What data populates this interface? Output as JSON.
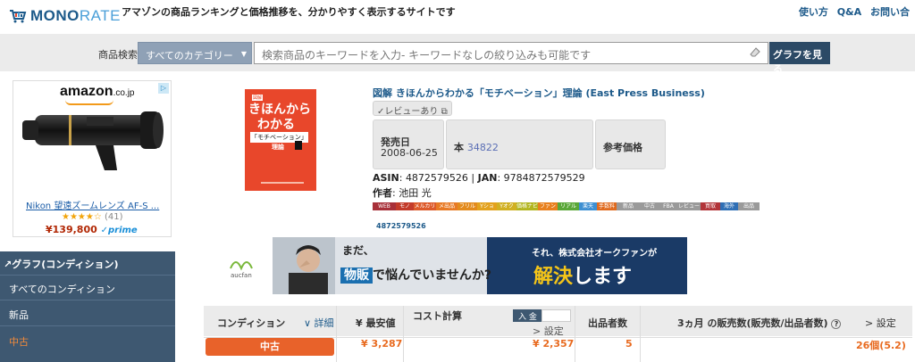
{
  "header": {
    "logo_text": "MONO",
    "logo_text2": "RATE",
    "tagline": "アマゾンの商品ランキングと価格推移を、分かりやすく表示するサイトです",
    "links": [
      "使い方",
      "Q&A",
      "お問い合"
    ]
  },
  "search": {
    "label": "商品検索",
    "category": "すべてのカテゴリー",
    "placeholder": "検索商品のキーワードを入力- キーワードなしの絞り込みも可能です",
    "button": "グラフを見る"
  },
  "ad": {
    "brand": "amazon",
    "brand_suffix": ".co.jp",
    "product": "Nikon 望遠ズームレンズ AF-S ...",
    "stars": "★★★★☆",
    "review_count": "(41)",
    "price": "¥139,800",
    "prime": "✓prime"
  },
  "condition_panel": {
    "title": "グラフ(コンディション)",
    "items": [
      "すべてのコンディション",
      "新品",
      "中古"
    ]
  },
  "book": {
    "cover_label_small": "図解",
    "cover_title1": "きほんから",
    "cover_title2": "わかる",
    "cover_title3": "「モチベーション」",
    "cover_title4": "理論",
    "title": "図解 きほんからわかる「モチベーション」理論 (East Press Business)",
    "review_badge": "✓レビューあり",
    "release_label": "発売日",
    "release_date": "2008-06-25",
    "format_label": "本",
    "format_rank": "34822",
    "ref_price_label": "参考価格",
    "asin_line_label1": "ASIN",
    "asin": "4872579526",
    "asin_line_label2": "JAN",
    "jan": "9784872579529",
    "author_label": "作者",
    "author": "池田 光",
    "asin_small": "4872579526"
  },
  "link_bar": [
    {
      "label": "WEB",
      "color": "#a8313a"
    },
    {
      "label": "モノ",
      "color": "#c33b2a"
    },
    {
      "label": "メルカリ",
      "color": "#dd5a2a"
    },
    {
      "label": "メ出品",
      "color": "#e87a25"
    },
    {
      "label": "フリル",
      "color": "#e38b1d"
    },
    {
      "label": "Yショ",
      "color": "#e3a21d"
    },
    {
      "label": "Yオク",
      "color": "#d1b021"
    },
    {
      "label": "価格ナビ",
      "color": "#b2b51e"
    },
    {
      "label": "ファン",
      "color": "#e8801e"
    },
    {
      "label": "リアル",
      "color": "#5aa739"
    },
    {
      "label": "楽天",
      "color": "#3d8fd2"
    },
    {
      "label": "手数料",
      "color": "#e06a1e"
    },
    {
      "label": "新品",
      "color": "#9a9a9a"
    },
    {
      "label": "中古",
      "color": "#9a9a9a"
    },
    {
      "label": "FBA",
      "color": "#9a9a9a"
    },
    {
      "label": "レビュー",
      "color": "#9a9a9a"
    },
    {
      "label": "買取",
      "color": "#b2353a"
    },
    {
      "label": "海外",
      "color": "#2f6fb5"
    },
    {
      "label": "出品",
      "color": "#9a9a9a"
    }
  ],
  "banner": {
    "line1": "まだ、",
    "line2a": "物販",
    "line2b": "で悩んでいませんか?",
    "right1": "それ、株式会社オークファンが",
    "right2a": "解決",
    "right2b": "します",
    "aucfan": "aucfan"
  },
  "table": {
    "headers": {
      "condition": "コンディション",
      "detail": "∨ 詳細",
      "lowest": "¥ 最安値",
      "cost": "コスト計算",
      "deposit": "入 金",
      "cost_setting": "> 設定",
      "sellers": "出品者数",
      "sales": "3ヵ月 の販売数(販売数/出品者数)",
      "sales_info": "?",
      "sales_setting": "> 設定"
    },
    "rows": [
      {
        "condition": "中古",
        "lowest": "¥ 3,287",
        "cost": "¥ 2,357",
        "sellers": "5",
        "sales": "26個(5.2)"
      }
    ]
  }
}
